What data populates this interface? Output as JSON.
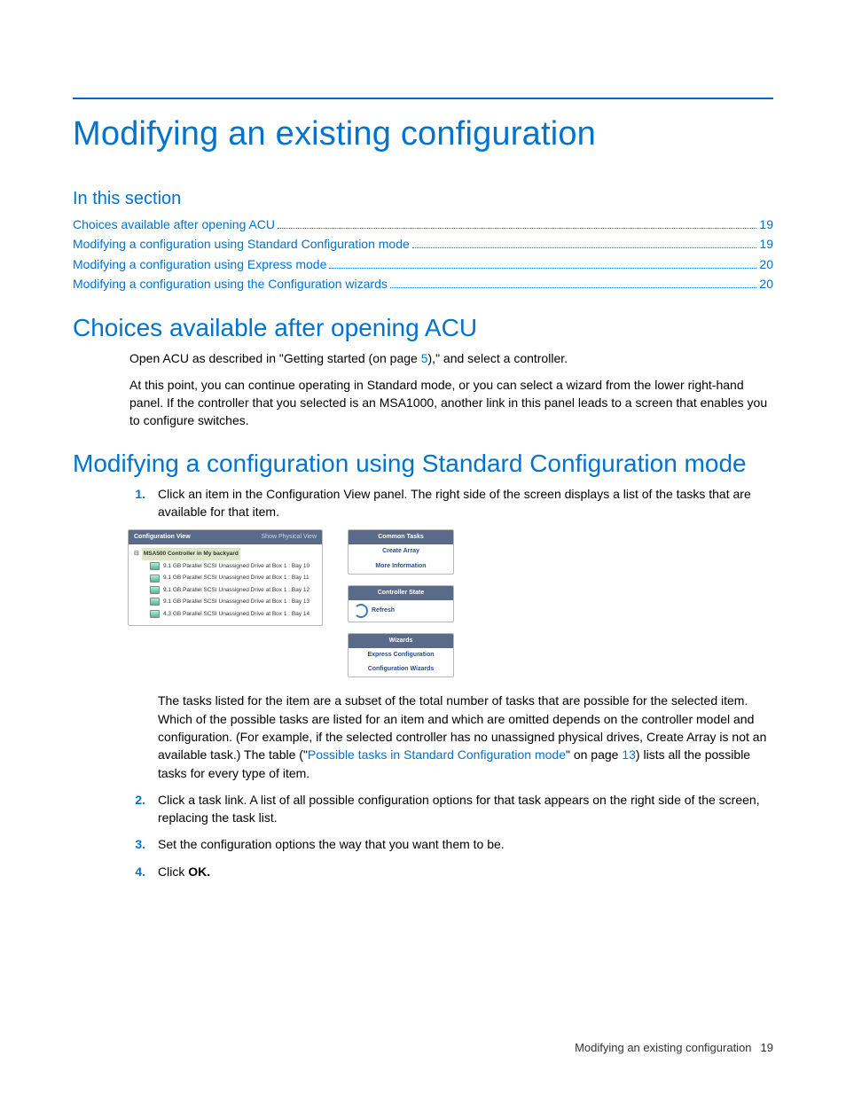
{
  "page_title": "Modifying an existing configuration",
  "toc_heading": "In this section",
  "toc": [
    {
      "label": "Choices available after opening ACU",
      "page": "19"
    },
    {
      "label": "Modifying a configuration using Standard Configuration mode",
      "page": "19"
    },
    {
      "label": "Modifying a configuration using Express mode",
      "page": "20"
    },
    {
      "label": "Modifying a configuration using the Configuration wizards",
      "page": "20"
    }
  ],
  "section1": {
    "heading": "Choices available after opening ACU",
    "p1_a": "Open ACU as described in \"Getting started (on page ",
    "p1_link": "5",
    "p1_b": "),\" and select a controller.",
    "p2": "At this point, you can continue operating in Standard mode, or you can select a wizard from the lower right-hand panel. If the controller that you selected is an MSA1000, another link in this panel leads to a screen that enables you to configure switches."
  },
  "section2": {
    "heading": "Modifying a configuration using Standard Configuration mode",
    "step1": "Click an item in the Configuration View panel. The right side of the screen displays a list of the tasks that are available for that item.",
    "step_body_a": "The tasks listed for the item are a subset of the total number of tasks that are possible for the selected item. Which of the possible tasks are listed for an item and which are omitted depends on the controller model and configuration. (For example, if the selected controller has no unassigned physical drives, Create Array is not an available task.) The table (\"",
    "step_body_link1": "Possible tasks in Standard Configuration mode",
    "step_body_b": "\" on page ",
    "step_body_link2": "13",
    "step_body_c": ") lists all the possible tasks for every type of item.",
    "step2": "Click a task link. A list of all possible configuration options for that task appears on the right side of the screen, replacing the task list.",
    "step3": "Set the configuration options the way that you want them to be.",
    "step4_a": "Click ",
    "step4_b": "OK."
  },
  "panel": {
    "left_header": "Configuration View",
    "left_header_right": "Show Physical View",
    "root": "MSA500 Controller in My backyard",
    "drives": [
      "9.1 GB Parallel SCSI Unassigned Drive at Box 1 : Bay 10",
      "9.1 GB Parallel SCSI Unassigned Drive at Box 1 : Bay 11",
      "9.1 GB Parallel SCSI Unassigned Drive at Box 1 : Bay 12",
      "9.1 GB Parallel SCSI Unassigned Drive at Box 1 : Bay 13",
      "4.3 GB Parallel SCSI Unassigned Drive at Box 1 : Bay 14"
    ],
    "common_header": "Common Tasks",
    "common_items": [
      "Create Array",
      "More Information"
    ],
    "state_header": "Controller State",
    "refresh": "Refresh",
    "wizards_header": "Wizards",
    "wizards_items": [
      "Express Configuration",
      "Configuration Wizards"
    ]
  },
  "footer": {
    "label": "Modifying an existing configuration",
    "page": "19"
  }
}
